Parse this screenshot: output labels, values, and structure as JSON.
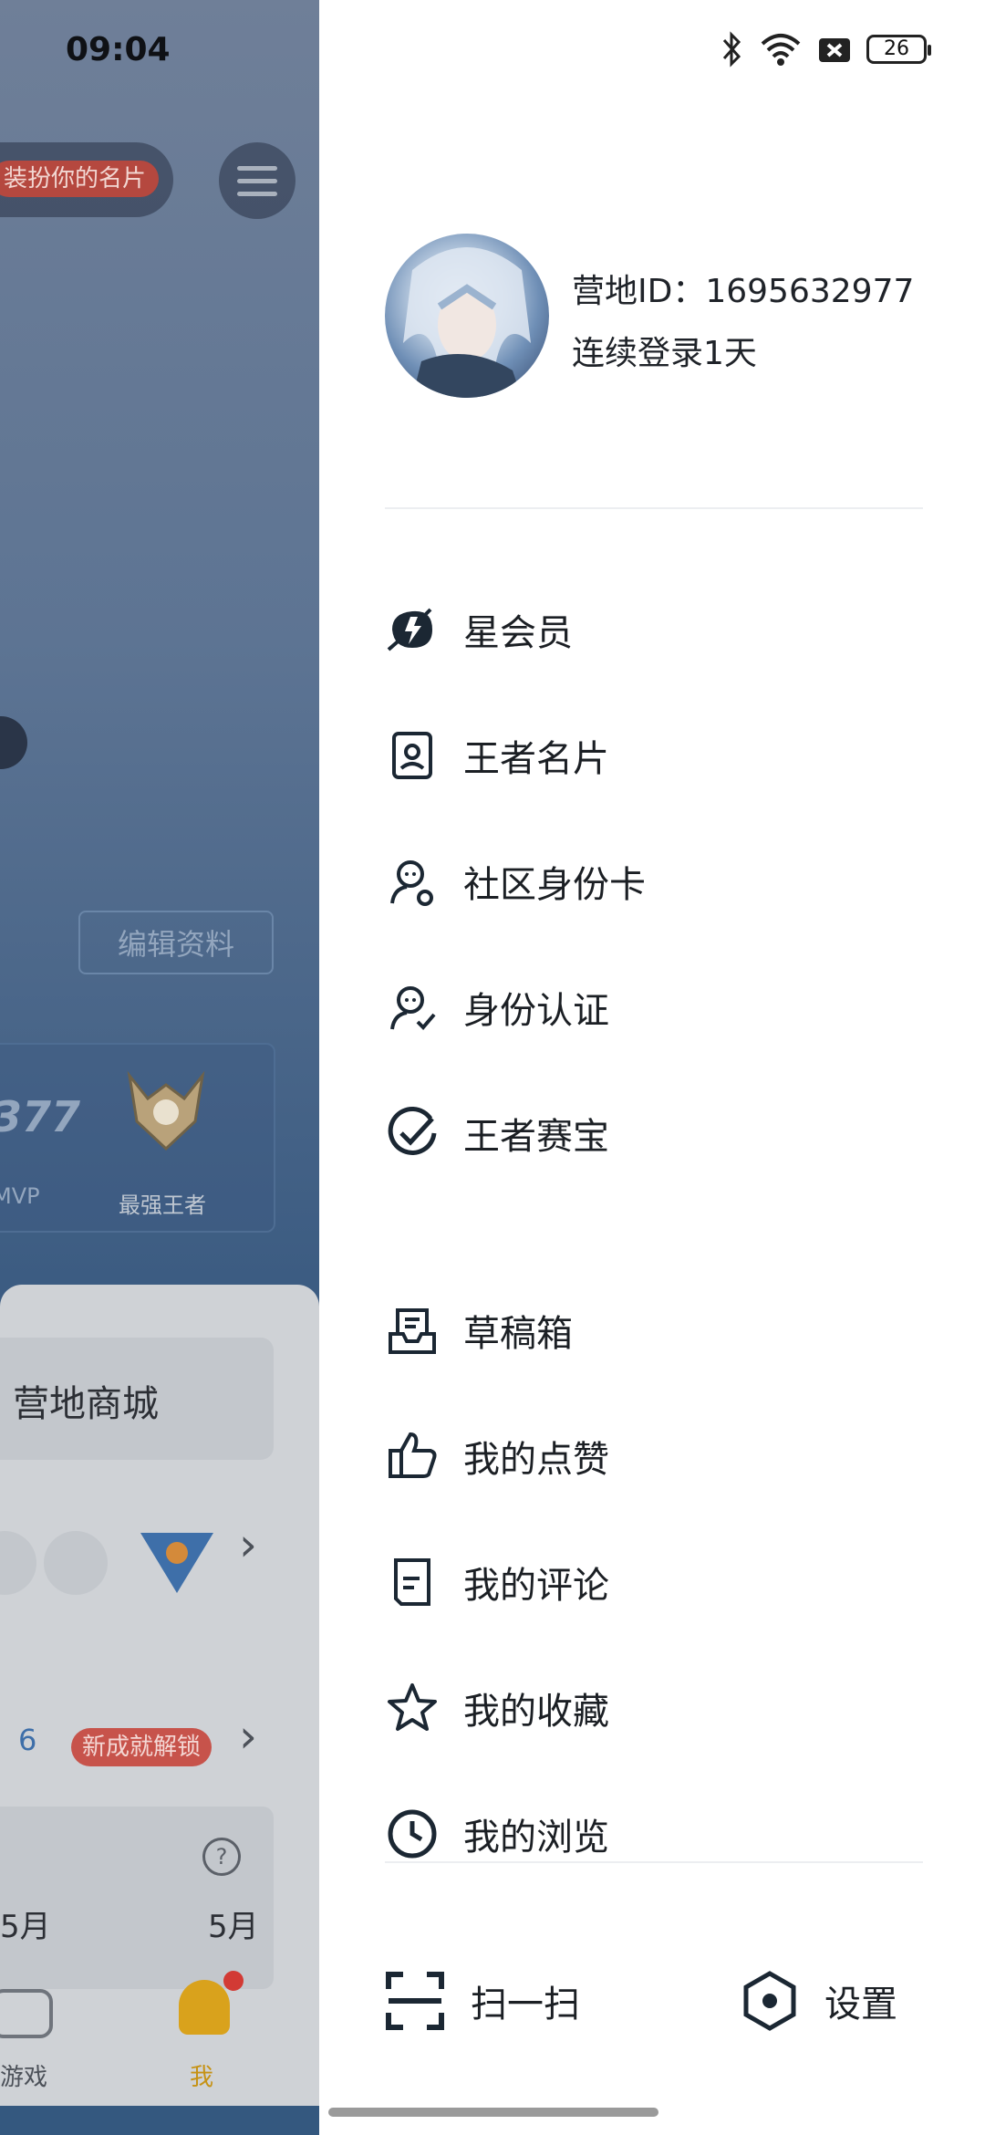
{
  "background_page": {
    "time": "09:04",
    "card_tag": "装扮你的名片",
    "edit_button": "编辑资料",
    "rank_number": "377",
    "rank_mvp": "MVP",
    "rank_label": "最强王者",
    "shop_label": "营地商城",
    "achievement_count": "6",
    "achievement_tag": "新成就解锁",
    "month_left": "5月",
    "month_right": "5月",
    "nav_games": "游戏",
    "nav_me": "我"
  },
  "status_bar": {
    "battery": "26"
  },
  "profile": {
    "camp_id": "营地ID：1695632977",
    "login_streak": "连续登录1天"
  },
  "menu_group_1": [
    {
      "label": "星会员",
      "icon": "star-member-icon"
    },
    {
      "label": "王者名片",
      "icon": "name-card-icon"
    },
    {
      "label": "社区身份卡",
      "icon": "community-id-icon"
    },
    {
      "label": "身份认证",
      "icon": "verify-identity-icon"
    },
    {
      "label": "王者赛宝",
      "icon": "check-badge-icon"
    }
  ],
  "menu_group_2": [
    {
      "label": "草稿箱",
      "icon": "drafts-icon"
    },
    {
      "label": "我的点赞",
      "icon": "thumbs-up-icon"
    },
    {
      "label": "我的评论",
      "icon": "comment-doc-icon"
    },
    {
      "label": "我的收藏",
      "icon": "star-icon"
    },
    {
      "label": "我的浏览",
      "icon": "clock-icon"
    }
  ],
  "bottom": {
    "scan_label": "扫一扫",
    "settings_label": "设置"
  }
}
